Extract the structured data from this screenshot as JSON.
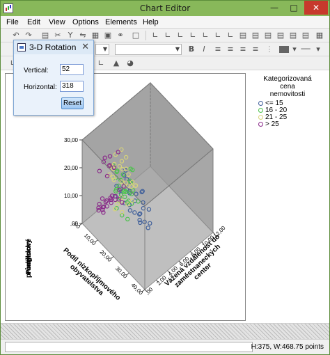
{
  "window": {
    "title": "Chart Editor"
  },
  "menu": [
    "File",
    "Edit",
    "View",
    "Options",
    "Elements",
    "Help"
  ],
  "dialog": {
    "title": "3-D Rotation",
    "vertical_label": "Vertical:",
    "vertical_value": "52",
    "horizontal_label": "Horizontal:",
    "horizontal_value": "318",
    "reset_label": "Reset"
  },
  "chart": {
    "z_label_lines": [
      "Podíl",
      "průmyslové",
      "plochy"
    ],
    "x_label_lines": [
      "Podíl nízkopříjmového",
      "obyvatelstva"
    ],
    "y_label_lines": [
      "Vážená vzdálenost do",
      "zaměstnaneckých",
      "center"
    ],
    "z_ticks": [
      ",00",
      "10,00",
      "20,00",
      "30,00"
    ],
    "x_ticks": [
      ",00",
      "10,00",
      "20,00",
      "30,00",
      "40,00"
    ],
    "y_ticks": [
      ",00",
      "2,00",
      "4,00",
      "6,00",
      "8,00",
      "10,00",
      "12,00"
    ]
  },
  "legend": {
    "title_lines": [
      "Kategorizovaná",
      "cena",
      "nemovitosti"
    ],
    "items": [
      {
        "label": "<= 15",
        "color": "#3f5f9a"
      },
      {
        "label": "16 - 20",
        "color": "#4cc24c"
      },
      {
        "label": "21 - 25",
        "color": "#d8d47a"
      },
      {
        "label": "> 25",
        "color": "#8a2a8a"
      }
    ]
  },
  "status": {
    "text": "H:375, W:468.75 points"
  },
  "chart_data": {
    "type": "scatter",
    "projection": "3d",
    "rotation": {
      "vertical": 52,
      "horizontal": 318
    },
    "axes": {
      "x": {
        "label": "Podíl nízkopříjmového obyvatelstva",
        "range": [
          0,
          40
        ]
      },
      "y": {
        "label": "Vážená vzdálenost do zaměstnaneckých center",
        "range": [
          0,
          12
        ]
      },
      "z": {
        "label": "Podíl průmyslové plochy",
        "range": [
          0,
          30
        ]
      }
    },
    "legend_title": "Kategorizovaná cena nemovitosti",
    "legend_position": "right",
    "series": [
      {
        "name": "<= 15",
        "points": [
          [
            22,
            1.4,
            18
          ],
          [
            24,
            1.7,
            18
          ],
          [
            28,
            1.5,
            18
          ],
          [
            30,
            1.8,
            18
          ],
          [
            32,
            1.3,
            18
          ],
          [
            26,
            2.1,
            20
          ],
          [
            34,
            1.6,
            18
          ],
          [
            20,
            1.2,
            19
          ],
          [
            18,
            1.9,
            18
          ],
          [
            36,
            2.0,
            18
          ],
          [
            25,
            2.6,
            21
          ],
          [
            28,
            3.0,
            19
          ],
          [
            22,
            2.3,
            20
          ],
          [
            17,
            1.1,
            18
          ],
          [
            30,
            2.5,
            19
          ],
          [
            33,
            1.1,
            18
          ],
          [
            27,
            1.0,
            19
          ],
          [
            15,
            3.5,
            22
          ],
          [
            24,
            4.0,
            19
          ],
          [
            23,
            1.5,
            27
          ],
          [
            21,
            1.6,
            27
          ],
          [
            18,
            1.8,
            20
          ],
          [
            20,
            2.8,
            22
          ],
          [
            29,
            2.2,
            17
          ],
          [
            31,
            3.2,
            18
          ],
          [
            37,
            1.4,
            18
          ],
          [
            19,
            2.6,
            19
          ],
          [
            25,
            3.6,
            20
          ],
          [
            14,
            2.2,
            18
          ],
          [
            26,
            1.2,
            25
          ]
        ]
      },
      {
        "name": "16 - 20",
        "points": [
          [
            14,
            2.2,
            10
          ],
          [
            16,
            2.6,
            8
          ],
          [
            12,
            3.1,
            10
          ],
          [
            18,
            2.4,
            18
          ],
          [
            15,
            3.8,
            10
          ],
          [
            10,
            4.1,
            9
          ],
          [
            20,
            2.0,
            18
          ],
          [
            13,
            4.6,
            8
          ],
          [
            11,
            2.9,
            18
          ],
          [
            17,
            3.3,
            6
          ],
          [
            9,
            5.2,
            8
          ],
          [
            19,
            1.9,
            20
          ],
          [
            12,
            5.4,
            5
          ],
          [
            16,
            4.0,
            18
          ],
          [
            8,
            3.7,
            10
          ],
          [
            14,
            5.0,
            19
          ],
          [
            10,
            3.4,
            19
          ],
          [
            21,
            2.7,
            19
          ],
          [
            13,
            2.5,
            22
          ],
          [
            15,
            4.4,
            21
          ],
          [
            18,
            3.6,
            19
          ],
          [
            11,
            4.6,
            10
          ],
          [
            9,
            3.0,
            21
          ],
          [
            20,
            3.2,
            17
          ],
          [
            12,
            3.9,
            18
          ],
          [
            16,
            1.6,
            19
          ],
          [
            7,
            4.5,
            10
          ],
          [
            14,
            6.0,
            6
          ],
          [
            17,
            2.1,
            22
          ],
          [
            22,
            2.9,
            20
          ]
        ]
      },
      {
        "name": "21 - 25",
        "points": [
          [
            10,
            3.0,
            6
          ],
          [
            8,
            4.0,
            5
          ],
          [
            12,
            3.6,
            9
          ],
          [
            6,
            5.2,
            4
          ],
          [
            11,
            2.4,
            19
          ],
          [
            9,
            4.5,
            20
          ],
          [
            13,
            2.0,
            20
          ],
          [
            7,
            3.3,
            19
          ],
          [
            5,
            6.0,
            6
          ],
          [
            14,
            3.1,
            18
          ],
          [
            8,
            5.5,
            10
          ],
          [
            10,
            2.7,
            21
          ],
          [
            6,
            4.0,
            18
          ],
          [
            12,
            4.7,
            6
          ],
          [
            4,
            7.0,
            4
          ],
          [
            9,
            6.2,
            8
          ],
          [
            11,
            1.8,
            21
          ],
          [
            7,
            5.8,
            18
          ],
          [
            15,
            2.9,
            8
          ],
          [
            5,
            4.5,
            20
          ],
          [
            13,
            5.2,
            7
          ],
          [
            3,
            8.0,
            3
          ],
          [
            8,
            7.2,
            6
          ],
          [
            10,
            5.0,
            17
          ],
          [
            6,
            6.5,
            10
          ],
          [
            12,
            3.3,
            22
          ],
          [
            4,
            5.8,
            19
          ],
          [
            9,
            2.3,
            22
          ],
          [
            7,
            7.5,
            5
          ],
          [
            11,
            4.1,
            19
          ]
        ]
      },
      {
        "name": "> 25",
        "points": [
          [
            6,
            2.0,
            6
          ],
          [
            5,
            3.0,
            4
          ],
          [
            4,
            2.5,
            3
          ],
          [
            7,
            1.8,
            5
          ],
          [
            3,
            3.5,
            4
          ],
          [
            5,
            1.5,
            6
          ],
          [
            8,
            2.2,
            18
          ],
          [
            4,
            4.0,
            3
          ],
          [
            6,
            3.2,
            19
          ],
          [
            2,
            4.5,
            2
          ],
          [
            7,
            2.8,
            20
          ],
          [
            3,
            2.2,
            5
          ],
          [
            5,
            4.5,
            5
          ],
          [
            8,
            1.6,
            8
          ],
          [
            4,
            3.8,
            20
          ],
          [
            2,
            6.0,
            3
          ],
          [
            6,
            4.8,
            4
          ],
          [
            3,
            5.5,
            18
          ],
          [
            7,
            3.9,
            6
          ],
          [
            5,
            2.4,
            21
          ],
          [
            4,
            1.8,
            4
          ],
          [
            8,
            3.4,
            19
          ],
          [
            2,
            3.0,
            5
          ],
          [
            6,
            1.4,
            20
          ],
          [
            3,
            6.5,
            4
          ],
          [
            7,
            5.1,
            3
          ],
          [
            5,
            3.6,
            6
          ],
          [
            1,
            5.0,
            2
          ],
          [
            4,
            2.9,
            21
          ],
          [
            6,
            2.5,
            7
          ]
        ]
      }
    ]
  }
}
